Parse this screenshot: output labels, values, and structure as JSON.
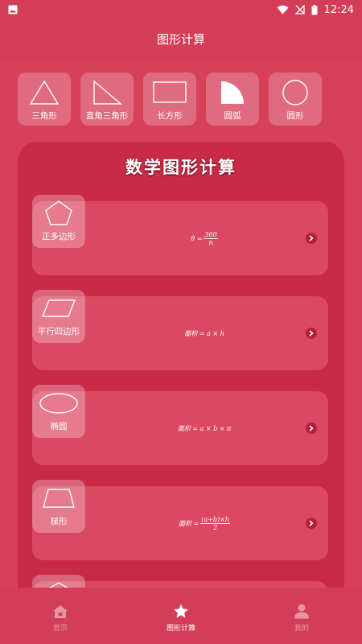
{
  "status": {
    "time": "12:24"
  },
  "header": {
    "title": "图形计算"
  },
  "shape_tabs": [
    {
      "label": "三角形",
      "icon": "triangle-icon"
    },
    {
      "label": "直角三角形",
      "icon": "right-triangle-icon"
    },
    {
      "label": "长方形",
      "icon": "rectangle-icon"
    },
    {
      "label": "圆弧",
      "icon": "arc-icon"
    },
    {
      "label": "圆形",
      "icon": "circle-icon"
    }
  ],
  "panel": {
    "title": "数学图形计算"
  },
  "cards": [
    {
      "label": "正多边形",
      "icon": "pentagon-icon",
      "formula_prefix": "θ = ",
      "formula_num": "360",
      "formula_den": "n"
    },
    {
      "label": "平行四边形",
      "icon": "parallelogram-icon",
      "formula": "面积 = a × h"
    },
    {
      "label": "椭圆",
      "icon": "ellipse-icon",
      "formula": "面积 = a × b × π"
    },
    {
      "label": "梯形",
      "icon": "trapezoid-icon",
      "formula_prefix": "面积 = ",
      "formula_num": "(a+b)×h",
      "formula_den": "2"
    }
  ],
  "nav": [
    {
      "label": "首页",
      "icon": "home-icon",
      "active": false
    },
    {
      "label": "图形计算",
      "icon": "star-icon",
      "active": true
    },
    {
      "label": "我的",
      "icon": "user-icon",
      "active": false
    }
  ]
}
